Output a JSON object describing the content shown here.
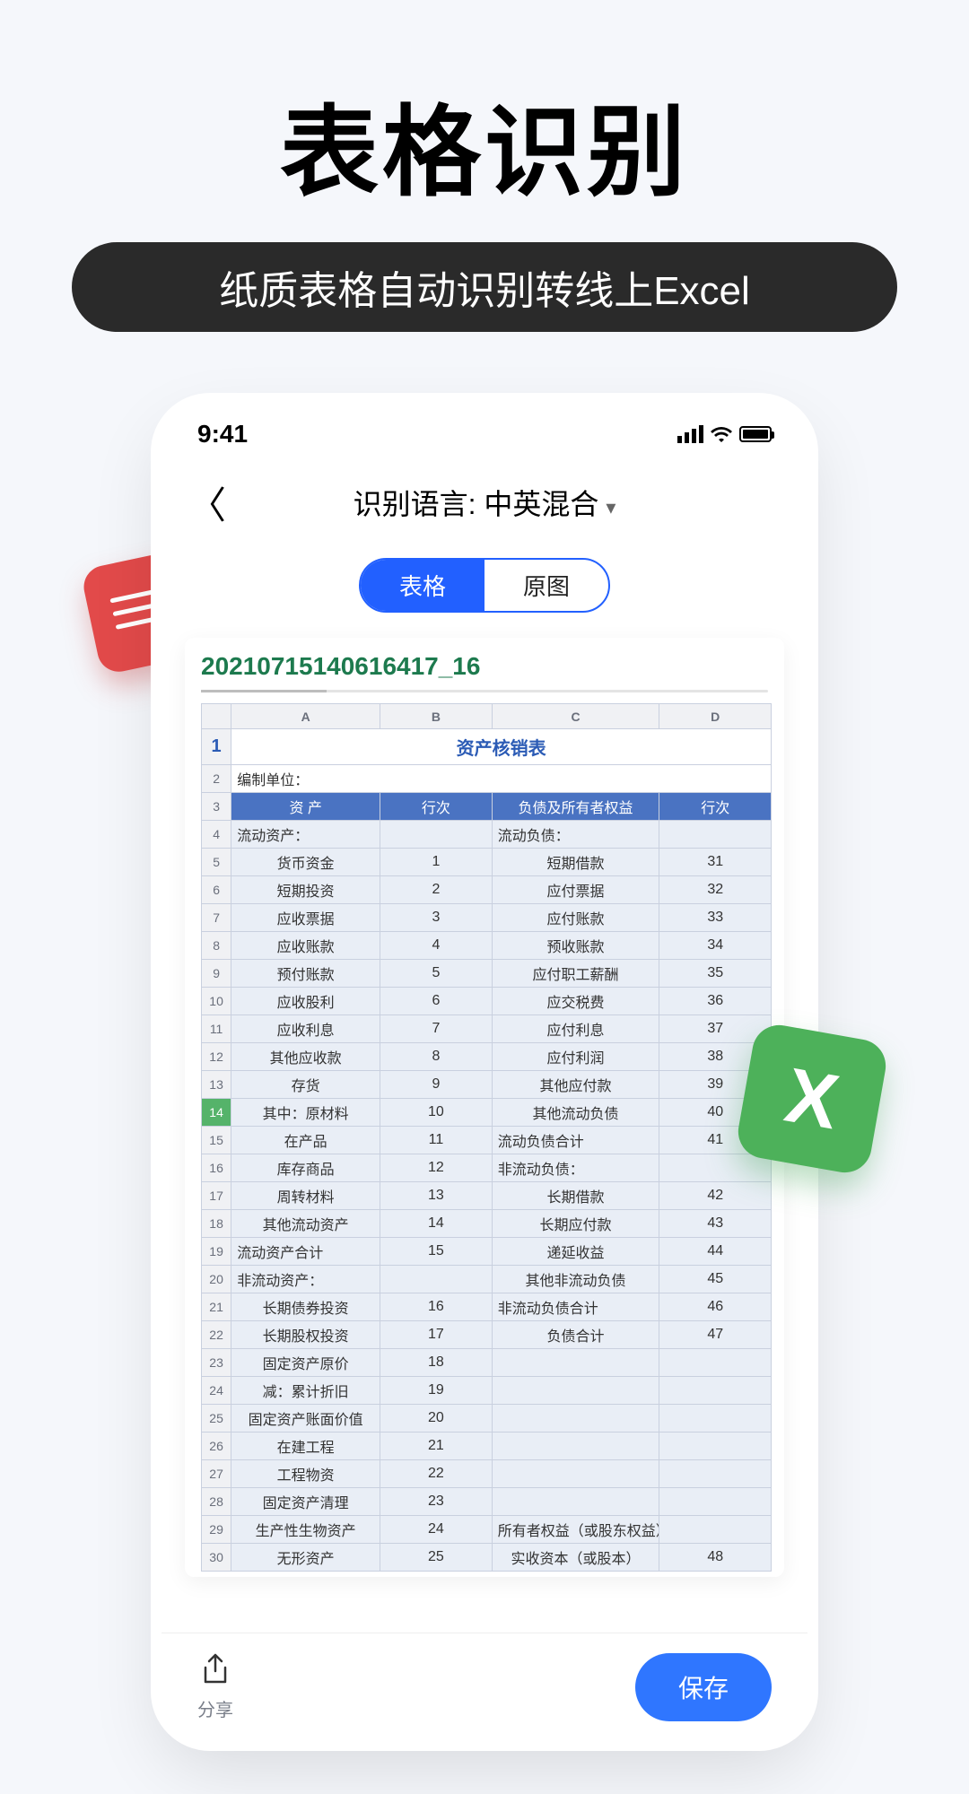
{
  "hero": {
    "title": "表格识别",
    "subtitle": "纸质表格自动识别转线上Excel"
  },
  "status": {
    "time": "9:41"
  },
  "nav": {
    "language_label": "识别语言: 中英混合"
  },
  "segmented": {
    "tab_table": "表格",
    "tab_image": "原图"
  },
  "doc": {
    "filename": "20210715140616417_16"
  },
  "sheet": {
    "columns": [
      "A",
      "B",
      "C",
      "D"
    ],
    "title": "资产核销表",
    "org_label": "编制单位：",
    "header": [
      "资 产",
      "行次",
      "负债及所有者权益",
      "行次"
    ],
    "rows": [
      [
        "流动资产：",
        "",
        "流动负债：",
        ""
      ],
      [
        "货币资金",
        "1",
        "短期借款",
        "31"
      ],
      [
        "短期投资",
        "2",
        "应付票据",
        "32"
      ],
      [
        "应收票据",
        "3",
        "应付账款",
        "33"
      ],
      [
        "应收账款",
        "4",
        "预收账款",
        "34"
      ],
      [
        "预付账款",
        "5",
        "应付职工薪酬",
        "35"
      ],
      [
        "应收股利",
        "6",
        "应交税费",
        "36"
      ],
      [
        "应收利息",
        "7",
        "应付利息",
        "37"
      ],
      [
        "其他应收款",
        "8",
        "应付利润",
        "38"
      ],
      [
        "存货",
        "9",
        "其他应付款",
        "39"
      ],
      [
        "其中：原材料",
        "10",
        "其他流动负债",
        "40"
      ],
      [
        "在产品",
        "11",
        "流动负债合计",
        "41"
      ],
      [
        "库存商品",
        "12",
        "非流动负债：",
        ""
      ],
      [
        "周转材料",
        "13",
        "长期借款",
        "42"
      ],
      [
        "其他流动资产",
        "14",
        "长期应付款",
        "43"
      ],
      [
        "流动资产合计",
        "15",
        "递延收益",
        "44"
      ],
      [
        "非流动资产：",
        "",
        "其他非流动负债",
        "45"
      ],
      [
        "长期债券投资",
        "16",
        "非流动负债合计",
        "46"
      ],
      [
        "长期股权投资",
        "17",
        "负债合计",
        "47"
      ],
      [
        "固定资产原价",
        "18",
        "",
        ""
      ],
      [
        "减：累计折旧",
        "19",
        "",
        ""
      ],
      [
        "固定资产账面价值",
        "20",
        "",
        ""
      ],
      [
        "在建工程",
        "21",
        "",
        ""
      ],
      [
        "工程物资",
        "22",
        "",
        ""
      ],
      [
        "固定资产清理",
        "23",
        "",
        ""
      ],
      [
        "生产性生物资产",
        "24",
        "所有者权益（或股东权益）：",
        ""
      ],
      [
        "无形资产",
        "25",
        "实收资本（或股本）",
        "48"
      ]
    ]
  },
  "bottom": {
    "share_label": "分享",
    "save_label": "保存"
  },
  "badge": {
    "excel": "X"
  }
}
